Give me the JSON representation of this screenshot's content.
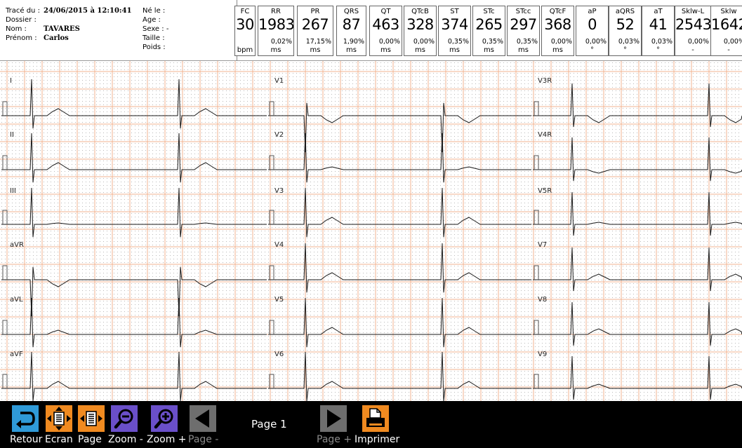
{
  "patient": {
    "trace_label": "Tracé du :",
    "trace_date": "24/06/2015 à 12:10:41",
    "dossier_label": "Dossier :",
    "nom_label": "Nom :",
    "nom_value": "TAVARES",
    "prenom_label": "Prénom :",
    "prenom_value": "Carlos",
    "ne_label": "Né le :",
    "age_label": "Age :",
    "sexe_label": "Sexe :  -",
    "taille_label": "Taille :",
    "poids_label": "Poids :"
  },
  "measures": [
    {
      "label": "FC",
      "value": "30",
      "pct": "",
      "unit": "bpm"
    },
    {
      "label": "RR",
      "value": "1983",
      "pct": "0,02%",
      "unit": "ms"
    },
    {
      "label": "PR",
      "value": "267",
      "pct": "17,15%",
      "unit": "ms"
    },
    {
      "label": "QRS",
      "value": "87",
      "pct": "1,90%",
      "unit": "ms"
    },
    {
      "label": "QT",
      "value": "463",
      "pct": "0,00%",
      "unit": "ms"
    },
    {
      "label": "QTcB",
      "value": "328",
      "pct": "0,00%",
      "unit": "ms"
    },
    {
      "label": "ST",
      "value": "374",
      "pct": "0,35%",
      "unit": "ms"
    },
    {
      "label": "STc",
      "value": "265",
      "pct": "0,35%",
      "unit": "ms"
    },
    {
      "label": "STcc",
      "value": "297",
      "pct": "0,35%",
      "unit": "ms"
    },
    {
      "label": "QTcF",
      "value": "368",
      "pct": "0,00%",
      "unit": "ms"
    },
    {
      "label": "aP",
      "value": "0",
      "pct": "0,00%",
      "unit": "°"
    },
    {
      "label": "aQRS",
      "value": "52",
      "pct": "0,03%",
      "unit": "°"
    },
    {
      "label": "aT",
      "value": "41",
      "pct": "0,03%",
      "unit": "°"
    },
    {
      "label": "Sklw-L",
      "value": "2543",
      "pct": "0,00%",
      "unit": "-"
    },
    {
      "label": "Sklw",
      "value": "1642",
      "pct": "0,00%",
      "unit": "-"
    }
  ],
  "leads": {
    "col1": [
      "I",
      "II",
      "III",
      "aVR",
      "aVL",
      "aVF"
    ],
    "col2": [
      "V1",
      "V2",
      "V3",
      "V4",
      "V5",
      "V6"
    ],
    "col3": [
      "V3R",
      "V4R",
      "V5R",
      "V7",
      "V8",
      "V9"
    ]
  },
  "colors": {
    "grid_major": "#f0b392",
    "grid_dot": "#b9b9b9",
    "trace": "#1a1a1a",
    "toolbar_bg": "#000000"
  },
  "toolbar": {
    "retour": "Retour",
    "ecran": "Ecran",
    "page": "Page",
    "zoom_minus": "Zoom -",
    "zoom_plus": "Zoom +",
    "page_minus": "Page -",
    "page_indicator": "Page 1",
    "page_plus": "Page +",
    "imprimer": "Imprimer"
  }
}
